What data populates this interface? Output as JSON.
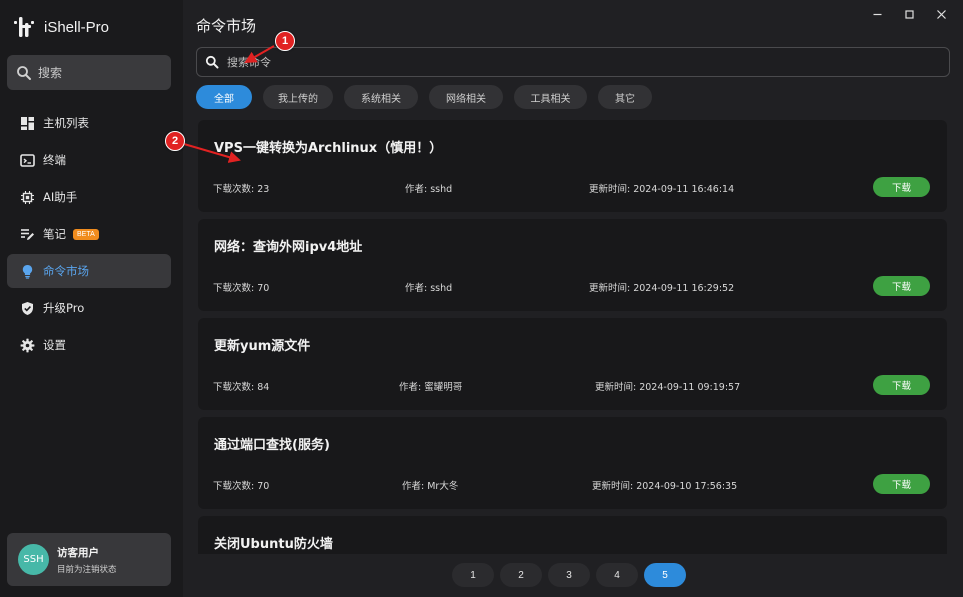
{
  "app": {
    "name": "iShell-Pro"
  },
  "sidebar": {
    "search_label": "搜索",
    "items": [
      {
        "label": "主机列表",
        "icon": "dashboard-icon",
        "active": false
      },
      {
        "label": "终端",
        "icon": "terminal-icon",
        "active": false
      },
      {
        "label": "AI助手",
        "icon": "chip-icon",
        "active": false
      },
      {
        "label": "笔记",
        "icon": "note-icon",
        "active": false,
        "badge": "BETA"
      },
      {
        "label": "命令市场",
        "icon": "bulb-icon",
        "active": true
      },
      {
        "label": "升级Pro",
        "icon": "shield-icon",
        "active": false
      },
      {
        "label": "设置",
        "icon": "gear-icon",
        "active": false
      }
    ],
    "user": {
      "avatar": "SSH",
      "name": "访客用户",
      "status": "目前为注销状态"
    }
  },
  "main": {
    "title": "命令市场",
    "search": {
      "placeholder": "搜索命令"
    },
    "tabs": [
      {
        "label": "全部",
        "active": true
      },
      {
        "label": "我上传的",
        "active": false
      },
      {
        "label": "系统相关",
        "active": false
      },
      {
        "label": "网络相关",
        "active": false
      },
      {
        "label": "工具相关",
        "active": false
      },
      {
        "label": "其它",
        "active": false
      }
    ],
    "cards": [
      {
        "title": "VPS一键转换为Archlinux（慎用！）",
        "downloads": "下载次数: 23",
        "author": "作者: sshd",
        "updated": "更新时间: 2024-09-11 16:46:14",
        "button": "下载"
      },
      {
        "title": "网络：查询外网ipv4地址",
        "downloads": "下载次数: 70",
        "author": "作者: sshd",
        "updated": "更新时间: 2024-09-11 16:29:52",
        "button": "下载"
      },
      {
        "title": "更新yum源文件",
        "downloads": "下载次数: 84",
        "author": "作者: 蜜罐明哥",
        "updated": "更新时间: 2024-09-11 09:19:57",
        "button": "下载"
      },
      {
        "title": "通过端口查找(服务)",
        "downloads": "下载次数: 70",
        "author": "作者: Mr大冬",
        "updated": "更新时间: 2024-09-10 17:56:35",
        "button": "下载"
      },
      {
        "title": "关闭Ubuntu防火墙"
      }
    ],
    "pagination": {
      "pages": [
        "1",
        "2",
        "3",
        "4",
        "5"
      ],
      "current": "5"
    }
  },
  "annotations": [
    "1",
    "2"
  ],
  "colors": {
    "accent": "#2d8bdb",
    "download": "#3ea142",
    "marker": "#e12222",
    "beta": "#f08c1e"
  }
}
